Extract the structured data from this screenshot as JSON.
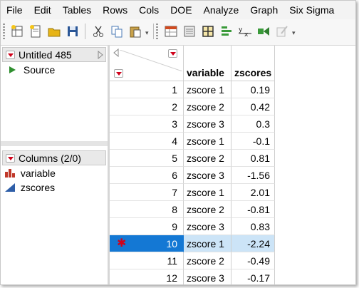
{
  "menu": [
    "File",
    "Edit",
    "Tables",
    "Rows",
    "Cols",
    "DOE",
    "Analyze",
    "Graph",
    "Six Sigma"
  ],
  "toolbar_icons": [
    "new-data-table-icon",
    "new-script-icon",
    "open-icon",
    "save-icon",
    "cut-icon",
    "copy-icon",
    "paste-icon",
    "data-table-view-icon",
    "journal-icon",
    "layout-icon",
    "distribution-icon",
    "fit-y-by-x-icon",
    "graph-builder-icon",
    "edit-icon"
  ],
  "table_panel": {
    "title": "Untitled 485",
    "source_label": "Source"
  },
  "columns_panel": {
    "title": "Columns (2/0)",
    "columns": [
      {
        "name": "variable",
        "icon": "nominal-bars-icon"
      },
      {
        "name": "zscores",
        "icon": "continuous-triangle-icon"
      }
    ]
  },
  "grid": {
    "headers": [
      "variable",
      "zscores"
    ],
    "rows": [
      {
        "n": "1",
        "variable": "zscore 1",
        "zscores": "0.19"
      },
      {
        "n": "2",
        "variable": "zscore 2",
        "zscores": "0.42"
      },
      {
        "n": "3",
        "variable": "zscore 3",
        "zscores": "0.3"
      },
      {
        "n": "4",
        "variable": "zscore 1",
        "zscores": "-0.1"
      },
      {
        "n": "5",
        "variable": "zscore 2",
        "zscores": "0.81"
      },
      {
        "n": "6",
        "variable": "zscore 3",
        "zscores": "-1.56"
      },
      {
        "n": "7",
        "variable": "zscore 1",
        "zscores": "2.01"
      },
      {
        "n": "8",
        "variable": "zscore 2",
        "zscores": "-0.81"
      },
      {
        "n": "9",
        "variable": "zscore 3",
        "zscores": "0.83"
      },
      {
        "n": "10",
        "variable": "zscore 1",
        "zscores": "-2.24",
        "selected": true,
        "marker": "✱"
      },
      {
        "n": "11",
        "variable": "zscore 2",
        "zscores": "-0.49"
      },
      {
        "n": "12",
        "variable": "zscore 3",
        "zscores": "-0.17"
      }
    ]
  },
  "colors": {
    "selected_row": "#1478d4",
    "selected_cell": "#cce4f7",
    "red_marker": "#d0021b"
  }
}
